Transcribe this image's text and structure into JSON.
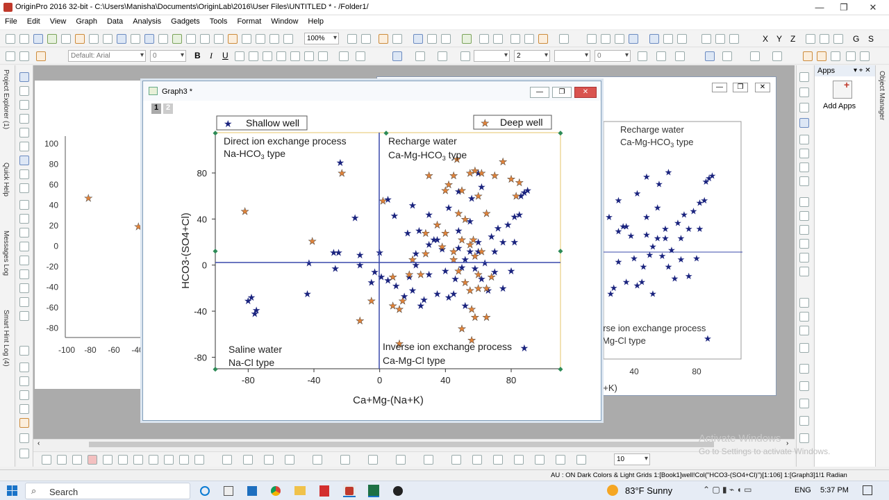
{
  "title_bar": {
    "title": "OriginPro 2016 32-bit - C:\\Users\\Manisha\\Documents\\OriginLab\\2016\\User Files\\UNTITLED * - /Folder1/",
    "minimize": "—",
    "maximize": "❐",
    "close": "✕"
  },
  "menu": [
    "File",
    "Edit",
    "View",
    "Graph",
    "Data",
    "Analysis",
    "Gadgets",
    "Tools",
    "Format",
    "Window",
    "Help"
  ],
  "toolbar": {
    "zoom": "100%",
    "font": "Default: Arial",
    "font_size": "0",
    "bold": "B",
    "italic": "I",
    "underline": "U",
    "line_width": "2",
    "pattern_size": "0",
    "bottom_combo": "10",
    "label_g": "G",
    "label_s": "S",
    "label_x": "X",
    "label_y": "Y",
    "label_z": "Z"
  },
  "left_dock": [
    "Project Explorer (1)",
    "Quick Help",
    "Messages Log",
    "Smart Hint Log (4)"
  ],
  "right_dock": [
    "Object Manager"
  ],
  "apps": {
    "header": "Apps",
    "add_label": "Add Apps"
  },
  "bg_left": {
    "y_ticks": [
      "100",
      "80",
      "60",
      "40",
      "20",
      "0",
      "-20",
      "-40",
      "-60",
      "-80"
    ],
    "x_ticks": [
      "-100",
      "-80",
      "-60",
      "-40"
    ]
  },
  "bg_right": {
    "label1": "Recharge water",
    "label2": "Ca-Mg-HCO",
    "label2_sub": "3",
    "label2_end": " type",
    "label3": "erse ion exchange process",
    "label4": "Mg-Cl type",
    "x_ticks": [
      "40",
      "80"
    ],
    "x_label": "a+K)"
  },
  "graph3": {
    "title": "Graph3 *",
    "layer1": "1",
    "layer2": "2",
    "legend1": "Shallow well",
    "legend2": "Deep well",
    "q1a": "Direct ion exchange process",
    "q1b_pre": "Na-HCO",
    "q1b_sub": "3",
    "q1b_post": " type",
    "q2a": "Recharge water",
    "q2b_pre": "Ca-Mg-HCO",
    "q2b_sub": "3",
    "q2b_post": " type",
    "q3a": "Saline water",
    "q3b": "Na-Cl type",
    "q4a": "Inverse ion exchange process",
    "q4b": "Ca-Mg-Cl type",
    "x_label": "Ca+Mg-(Na+K)",
    "y_label": "HCO3-(SO4+Cl)"
  },
  "chart_data": {
    "type": "scatter",
    "xlabel": "Ca+Mg-(Na+K)",
    "ylabel": "HCO3-(SO4+Cl)",
    "xlim": [
      -100,
      110
    ],
    "ylim": [
      -90,
      115
    ],
    "x_ticks": [
      -80,
      -40,
      0,
      40,
      80
    ],
    "y_ticks": [
      80,
      40,
      0,
      -40,
      -80
    ],
    "series": [
      {
        "name": "Shallow well",
        "color": "#1a237e",
        "points": [
          [
            -24,
            89
          ],
          [
            -15,
            41
          ],
          [
            -28,
            11
          ],
          [
            -25,
            11
          ],
          [
            -27,
            -3
          ],
          [
            -12,
            9
          ],
          [
            -12,
            0
          ],
          [
            -43,
            2
          ],
          [
            -44,
            -25
          ],
          [
            -78,
            -28
          ],
          [
            -80,
            -31
          ],
          [
            -75,
            -39
          ],
          [
            -76,
            -42
          ],
          [
            5,
            57
          ],
          [
            9,
            43
          ],
          [
            0,
            11
          ],
          [
            -5,
            -15
          ],
          [
            -3,
            -6
          ],
          [
            1,
            -10
          ],
          [
            5,
            -13
          ],
          [
            10,
            -18
          ],
          [
            12,
            -38
          ],
          [
            15,
            -27
          ],
          [
            20,
            -22
          ],
          [
            18,
            -10
          ],
          [
            22,
            0
          ],
          [
            17,
            28
          ],
          [
            20,
            52
          ],
          [
            24,
            30
          ],
          [
            30,
            44
          ],
          [
            30,
            18
          ],
          [
            22,
            10
          ],
          [
            35,
            22
          ],
          [
            38,
            14
          ],
          [
            42,
            50
          ],
          [
            48,
            30
          ],
          [
            55,
            38
          ],
          [
            60,
            12
          ],
          [
            52,
            5
          ],
          [
            50,
            -2
          ],
          [
            46,
            -12
          ],
          [
            45,
            -25
          ],
          [
            52,
            -35
          ],
          [
            62,
            -12
          ],
          [
            70,
            -6
          ],
          [
            66,
            -22
          ],
          [
            75,
            -20
          ],
          [
            80,
            -5
          ],
          [
            82,
            20
          ],
          [
            78,
            35
          ],
          [
            82,
            42
          ],
          [
            85,
            44
          ],
          [
            86,
            60
          ],
          [
            88,
            63
          ],
          [
            90,
            65
          ],
          [
            60,
            80
          ],
          [
            62,
            68
          ],
          [
            48,
            64
          ],
          [
            56,
            58
          ],
          [
            33,
            22
          ],
          [
            30,
            -8
          ],
          [
            35,
            -25
          ],
          [
            27,
            -30
          ],
          [
            40,
            -5
          ],
          [
            58,
            -3
          ],
          [
            64,
            2
          ],
          [
            70,
            12
          ],
          [
            75,
            20
          ],
          [
            68,
            25
          ],
          [
            72,
            32
          ],
          [
            60,
            20
          ],
          [
            55,
            12
          ],
          [
            48,
            15
          ],
          [
            42,
            -28
          ],
          [
            25,
            -35
          ],
          [
            88,
            -72
          ]
        ]
      },
      {
        "name": "Deep well",
        "color": "#e0833a",
        "points": [
          [
            -23,
            80
          ],
          [
            -82,
            47
          ],
          [
            -41,
            21
          ],
          [
            -12,
            -48
          ],
          [
            -5,
            -31
          ],
          [
            2,
            56
          ],
          [
            14,
            -31
          ],
          [
            12,
            -38
          ],
          [
            20,
            5
          ],
          [
            25,
            -8
          ],
          [
            18,
            -8
          ],
          [
            28,
            28
          ],
          [
            30,
            78
          ],
          [
            35,
            35
          ],
          [
            40,
            65
          ],
          [
            42,
            70
          ],
          [
            45,
            78
          ],
          [
            47,
            92
          ],
          [
            50,
            65
          ],
          [
            55,
            80
          ],
          [
            58,
            82
          ],
          [
            60,
            60
          ],
          [
            62,
            80
          ],
          [
            65,
            45
          ],
          [
            70,
            78
          ],
          [
            75,
            90
          ],
          [
            80,
            75
          ],
          [
            85,
            72
          ],
          [
            83,
            60
          ],
          [
            48,
            45
          ],
          [
            52,
            40
          ],
          [
            50,
            22
          ],
          [
            55,
            18
          ],
          [
            57,
            22
          ],
          [
            62,
            12
          ],
          [
            58,
            8
          ],
          [
            45,
            12
          ],
          [
            48,
            -5
          ],
          [
            52,
            -15
          ],
          [
            55,
            -22
          ],
          [
            56,
            -38
          ],
          [
            58,
            -45
          ],
          [
            60,
            -20
          ],
          [
            65,
            -20
          ],
          [
            68,
            -10
          ],
          [
            60,
            -8
          ],
          [
            50,
            -55
          ],
          [
            56,
            -65
          ],
          [
            65,
            -45
          ],
          [
            8,
            -10
          ],
          [
            8,
            -35
          ],
          [
            12,
            -68
          ],
          [
            28,
            10
          ],
          [
            40,
            28
          ],
          [
            38,
            16
          ],
          [
            45,
            5
          ]
        ]
      }
    ]
  },
  "status": {
    "text": "AU : ON   Dark Colors & Light Grids   1:[Book1]well!Col(\"HCO3-(SO4+Cl)\")[1:106]   1:[Graph3]1!1   Radian"
  },
  "taskbar": {
    "search_placeholder": "Search",
    "weather": "83°F  Sunny",
    "lang": "ENG",
    "time": "5:37 PM"
  },
  "watermark": {
    "line1": "Activate Windows",
    "line2": "Go to Settings to activate Windows."
  }
}
